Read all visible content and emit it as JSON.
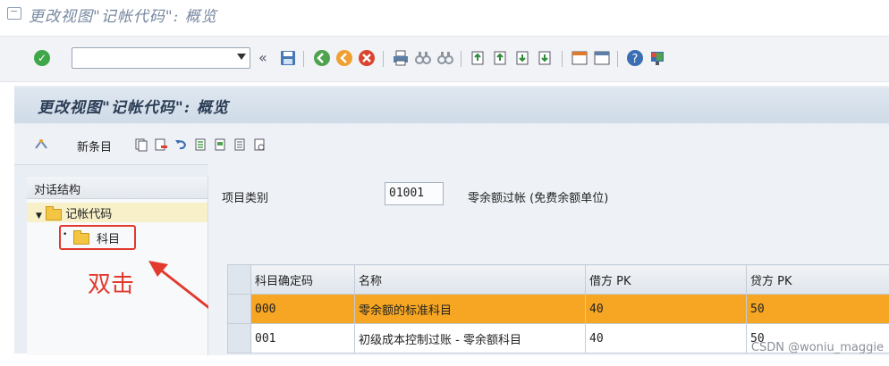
{
  "window": {
    "title": "更改视图\"记帐代码\": 概览"
  },
  "toolbar": {
    "command_value": "",
    "nav_back": "«"
  },
  "page": {
    "title": "更改视图\"记帐代码\": 概览",
    "new_entry_label": "新条目"
  },
  "tree": {
    "header": "对话结构",
    "root_label": "记帐代码",
    "child_label": "科目"
  },
  "annotation": {
    "text": "双击"
  },
  "form": {
    "item_category_label": "项目类别",
    "item_category_value": "01001",
    "item_category_desc": "零余额过帐 (免费余额单位)"
  },
  "table": {
    "headers": [
      "科目确定码",
      "名称",
      "借方 PK",
      "贷方 PK"
    ],
    "rows": [
      [
        "000",
        "零余额的标准科目",
        "40",
        "50"
      ],
      [
        "001",
        "初级成本控制过账 - 零余额科目",
        "40",
        "50"
      ]
    ]
  },
  "watermark": "CSDN @woniu_maggie",
  "colors": {
    "highlight_row": "#f6a623",
    "annotation_red": "#e23b2e"
  }
}
